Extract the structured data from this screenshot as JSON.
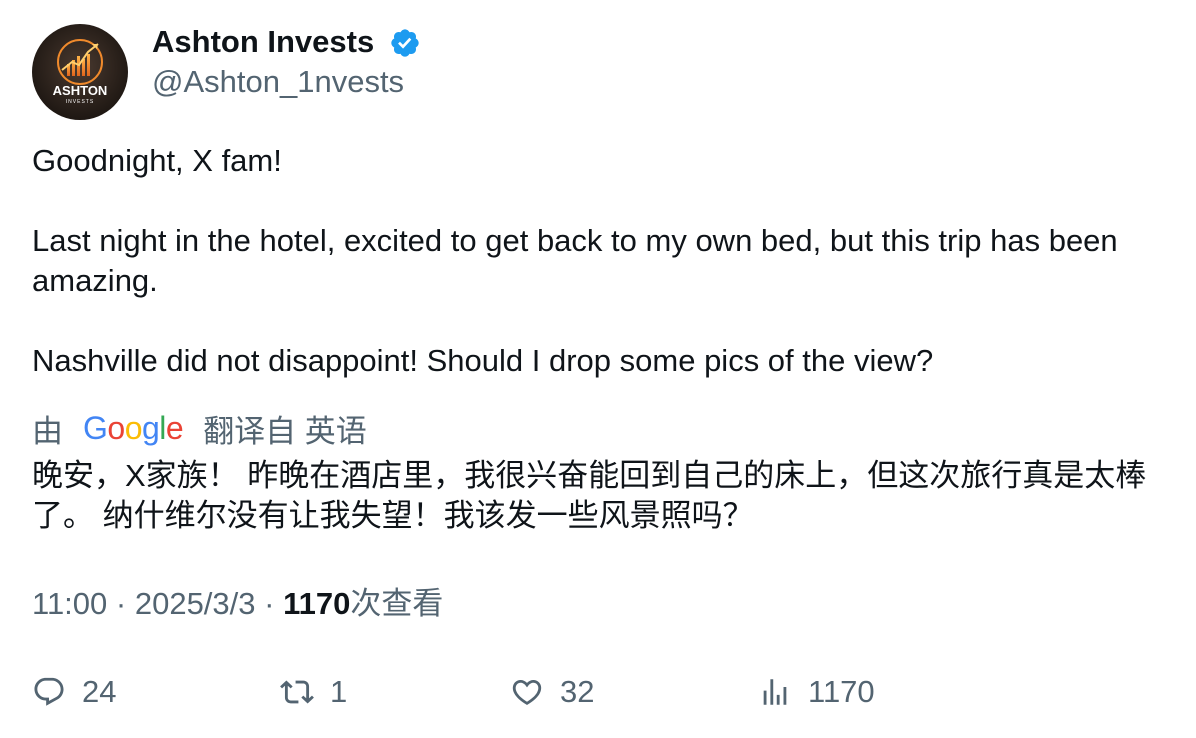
{
  "author": {
    "display_name": "Ashton Invests",
    "handle": "@Ashton_1nvests",
    "avatar_text": "ASHTON",
    "avatar_subtext": "INVESTS",
    "verified_color": "#1d9bf0"
  },
  "tweet": {
    "paragraphs": [
      "Goodnight, X fam!",
      "Last night in the hotel, excited to get back to my own bed, but this trip has been amazing.",
      "Nashville did not disappoint! Should I drop some pics of the view?"
    ]
  },
  "translation": {
    "by_label": "由",
    "provider": "Google",
    "from_label": "翻译自 英语",
    "text": "晚安，X家族！ 昨晚在酒店里，我很兴奋能回到自己的床上，但这次旅行真是太棒了。 纳什维尔没有让我失望！我该发一些风景照吗？"
  },
  "meta": {
    "time": "11:00",
    "separator": " · ",
    "date": "2025/3/3",
    "views_count": "1170",
    "views_label": "次查看"
  },
  "actions": {
    "replies": "24",
    "retweets": "1",
    "likes": "32",
    "views": "1170"
  },
  "colors": {
    "text_primary": "#0f1419",
    "text_secondary": "#536471",
    "google_blue": "#4285f4",
    "google_red": "#ea4335",
    "google_yellow": "#fbbc05",
    "google_green": "#34a853"
  }
}
